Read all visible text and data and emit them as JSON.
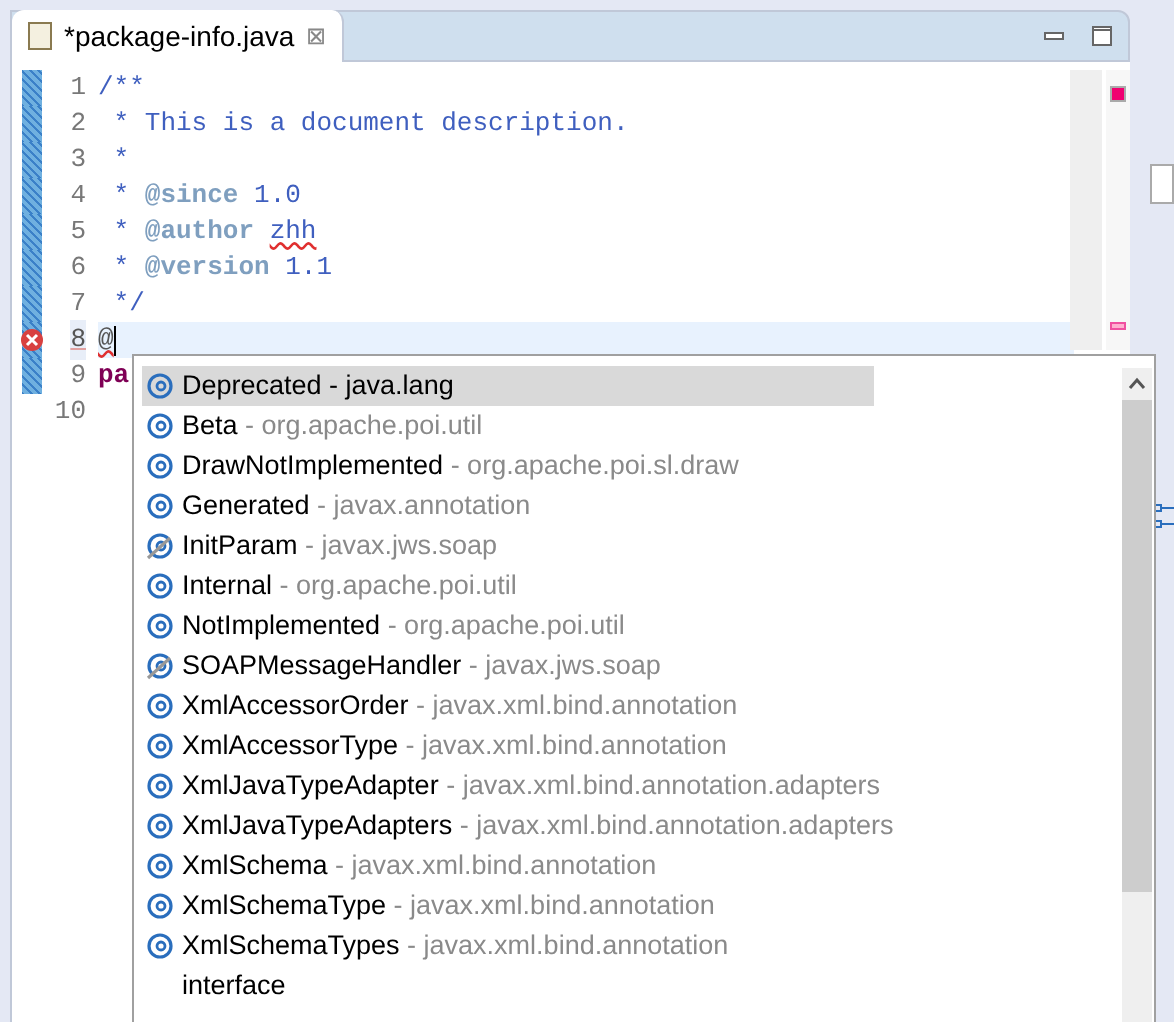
{
  "tab": {
    "title": "*package-info.java",
    "close": "⊠"
  },
  "lines": [
    {
      "number": "1",
      "error": false,
      "current": false,
      "segments": [
        {
          "kind": "comment",
          "text": "/**"
        }
      ]
    },
    {
      "number": "2",
      "error": false,
      "current": false,
      "segments": [
        {
          "kind": "comment",
          "text": " * This is a document description."
        }
      ]
    },
    {
      "number": "3",
      "error": false,
      "current": false,
      "segments": [
        {
          "kind": "comment",
          "text": " *"
        }
      ]
    },
    {
      "number": "4",
      "error": false,
      "current": false,
      "segments": [
        {
          "kind": "comment",
          "text": " * "
        },
        {
          "kind": "tag",
          "text": "@since"
        },
        {
          "kind": "comment",
          "text": " 1.0"
        }
      ]
    },
    {
      "number": "5",
      "error": false,
      "current": false,
      "segments": [
        {
          "kind": "comment",
          "text": " * "
        },
        {
          "kind": "tag",
          "text": "@author "
        },
        {
          "kind": "misspelled",
          "text": "zhh"
        }
      ]
    },
    {
      "number": "6",
      "error": false,
      "current": false,
      "segments": [
        {
          "kind": "comment",
          "text": " * "
        },
        {
          "kind": "tag",
          "text": "@version"
        },
        {
          "kind": "comment",
          "text": " 1.1"
        }
      ]
    },
    {
      "number": "7",
      "error": false,
      "current": false,
      "segments": [
        {
          "kind": "comment",
          "text": " */"
        }
      ]
    },
    {
      "number": "8",
      "error": true,
      "current": true,
      "segments": [
        {
          "kind": "misspelled-plain",
          "text": "@"
        }
      ]
    },
    {
      "number": "9",
      "error": false,
      "current": false,
      "segments": [
        {
          "kind": "keyword",
          "text": "pa"
        }
      ]
    },
    {
      "number": "10",
      "error": false,
      "current": false
    }
  ],
  "proposals": [
    {
      "kind": "annotation",
      "name": "Deprecated",
      "package": " - java.lang",
      "selected": true
    },
    {
      "kind": "annotation",
      "name": "Beta",
      "package": " - org.apache.poi.util",
      "selected": false
    },
    {
      "kind": "annotation",
      "name": "DrawNotImplemented",
      "package": " - org.apache.poi.sl.draw",
      "selected": false
    },
    {
      "kind": "annotation",
      "name": "Generated",
      "package": " - javax.annotation",
      "selected": false
    },
    {
      "kind": "annotation-slashed",
      "name": "InitParam",
      "package": " - javax.jws.soap",
      "selected": false
    },
    {
      "kind": "annotation",
      "name": "Internal",
      "package": " - org.apache.poi.util",
      "selected": false
    },
    {
      "kind": "annotation",
      "name": "NotImplemented",
      "package": " - org.apache.poi.util",
      "selected": false
    },
    {
      "kind": "annotation-slashed",
      "name": "SOAPMessageHandler",
      "package": " - javax.jws.soap",
      "selected": false
    },
    {
      "kind": "annotation",
      "name": "XmlAccessorOrder",
      "package": " - javax.xml.bind.annotation",
      "selected": false
    },
    {
      "kind": "annotation",
      "name": "XmlAccessorType",
      "package": " - javax.xml.bind.annotation",
      "selected": false
    },
    {
      "kind": "annotation",
      "name": "XmlJavaTypeAdapter",
      "package": " - javax.xml.bind.annotation.adapters",
      "selected": false
    },
    {
      "kind": "annotation",
      "name": "XmlJavaTypeAdapters",
      "package": " - javax.xml.bind.annotation.adapters",
      "selected": false
    },
    {
      "kind": "annotation",
      "name": "XmlSchema",
      "package": " - javax.xml.bind.annotation",
      "selected": false
    },
    {
      "kind": "annotation",
      "name": "XmlSchemaType",
      "package": " - javax.xml.bind.annotation",
      "selected": false
    },
    {
      "kind": "annotation",
      "name": "XmlSchemaTypes",
      "package": " - javax.xml.bind.annotation",
      "selected": false
    },
    {
      "kind": "template",
      "name": "interface",
      "selected": false
    }
  ]
}
